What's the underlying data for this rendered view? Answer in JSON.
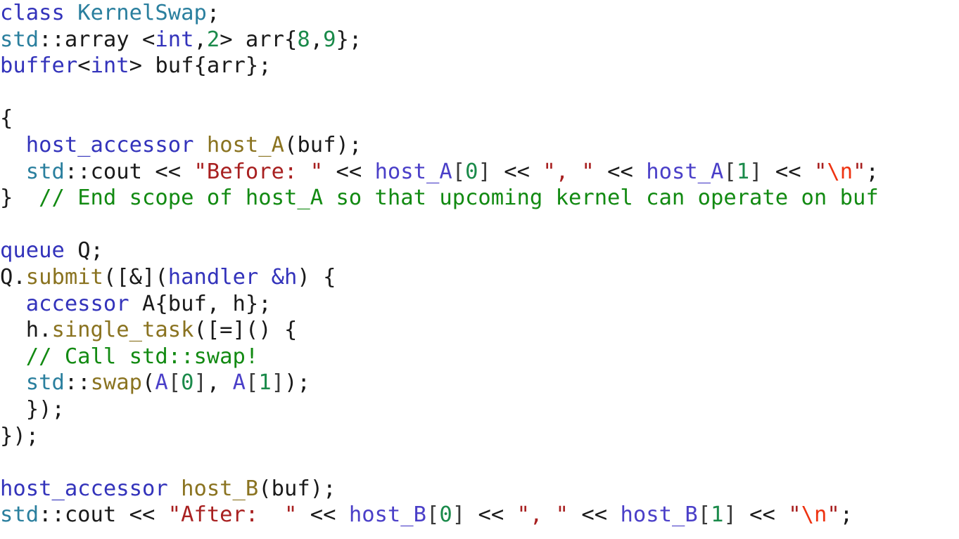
{
  "document": {
    "kind": "source-code-listing",
    "language": "C++ / SYCL",
    "background_color": "#ffffff",
    "colors": {
      "plain": "#1a1a1a",
      "keyword": "#3333bb",
      "type": "#2a7f9e",
      "function": "#8a7320",
      "number": "#1a8a4a",
      "string": "#a82020",
      "escape": "#ee3311",
      "comment": "#128a12",
      "variable": "#4a3fc8",
      "bracket": "#3a3a3a"
    },
    "plain_text": "class KernelSwap;\nstd::array <int,2> arr{8,9};\nbuffer<int> buf{arr};\n\n{\n  host_accessor host_A(buf);\n  std::cout << \"Before: \" << host_A[0] << \", \" << host_A[1] << \"\\n\";\n}  // End scope of host_A so that upcoming kernel can operate on buf\n\nqueue Q;\nQ.submit([&](handler &h) {\n  accessor A{buf, h};\n  h.single_task([=]() {\n  // Call std::swap!\n  std::swap(A[0], A[1]);\n  });\n});\n\nhost_accessor host_B(buf);\nstd::cout << \"After:  \" << host_B[0] << \", \" << host_B[1] << \"\\n\";",
    "lines": [
      {
        "n": 1,
        "tokens": [
          {
            "text": "class",
            "cls": "t-kw"
          },
          {
            "text": " ",
            "cls": "t-plain"
          },
          {
            "text": "KernelSwap",
            "cls": "t-type"
          },
          {
            "text": ";",
            "cls": "t-plain"
          }
        ]
      },
      {
        "n": 2,
        "tokens": [
          {
            "text": "std",
            "cls": "t-type"
          },
          {
            "text": "::array <",
            "cls": "t-plain"
          },
          {
            "text": "int",
            "cls": "t-kw"
          },
          {
            "text": ",",
            "cls": "t-plain"
          },
          {
            "text": "2",
            "cls": "t-num"
          },
          {
            "text": "> arr{",
            "cls": "t-plain"
          },
          {
            "text": "8",
            "cls": "t-num"
          },
          {
            "text": ",",
            "cls": "t-plain"
          },
          {
            "text": "9",
            "cls": "t-num"
          },
          {
            "text": "};",
            "cls": "t-plain"
          }
        ]
      },
      {
        "n": 3,
        "tokens": [
          {
            "text": "buffer",
            "cls": "t-kw"
          },
          {
            "text": "<",
            "cls": "t-plain"
          },
          {
            "text": "int",
            "cls": "t-kw"
          },
          {
            "text": "> buf{arr};",
            "cls": "t-plain"
          }
        ]
      },
      {
        "n": 4,
        "tokens": [
          {
            "text": " ",
            "cls": "t-plain"
          }
        ]
      },
      {
        "n": 5,
        "tokens": [
          {
            "text": "{",
            "cls": "t-plain"
          }
        ]
      },
      {
        "n": 6,
        "tokens": [
          {
            "text": "  ",
            "cls": "t-plain"
          },
          {
            "text": "host_accessor",
            "cls": "t-kw"
          },
          {
            "text": " ",
            "cls": "t-plain"
          },
          {
            "text": "host_A",
            "cls": "t-fn"
          },
          {
            "text": "(buf);",
            "cls": "t-plain"
          }
        ]
      },
      {
        "n": 7,
        "tokens": [
          {
            "text": "  ",
            "cls": "t-plain"
          },
          {
            "text": "std",
            "cls": "t-type"
          },
          {
            "text": "::cout << ",
            "cls": "t-plain"
          },
          {
            "text": "\"Before: \"",
            "cls": "t-str"
          },
          {
            "text": " << ",
            "cls": "t-plain"
          },
          {
            "text": "host_A",
            "cls": "t-var"
          },
          {
            "text": "[",
            "cls": "t-brk"
          },
          {
            "text": "0",
            "cls": "t-num"
          },
          {
            "text": "]",
            "cls": "t-brk"
          },
          {
            "text": " << ",
            "cls": "t-plain"
          },
          {
            "text": "\", \"",
            "cls": "t-str"
          },
          {
            "text": " << ",
            "cls": "t-plain"
          },
          {
            "text": "host_A",
            "cls": "t-var"
          },
          {
            "text": "[",
            "cls": "t-brk"
          },
          {
            "text": "1",
            "cls": "t-num"
          },
          {
            "text": "]",
            "cls": "t-brk"
          },
          {
            "text": " << ",
            "cls": "t-plain"
          },
          {
            "text": "\"",
            "cls": "t-str"
          },
          {
            "text": "\\n",
            "cls": "t-esc"
          },
          {
            "text": "\"",
            "cls": "t-str"
          },
          {
            "text": ";",
            "cls": "t-plain"
          }
        ]
      },
      {
        "n": 8,
        "tokens": [
          {
            "text": "}",
            "cls": "t-plain"
          },
          {
            "text": "  ",
            "cls": "t-plain"
          },
          {
            "text": "// End scope of host_A so that upcoming kernel can operate on buf",
            "cls": "t-cmt"
          }
        ]
      },
      {
        "n": 9,
        "tokens": [
          {
            "text": " ",
            "cls": "t-plain"
          }
        ]
      },
      {
        "n": 10,
        "tokens": [
          {
            "text": "queue",
            "cls": "t-kw"
          },
          {
            "text": " Q;",
            "cls": "t-plain"
          }
        ]
      },
      {
        "n": 11,
        "tokens": [
          {
            "text": "Q.",
            "cls": "t-plain"
          },
          {
            "text": "submit",
            "cls": "t-fn"
          },
          {
            "text": "([&](",
            "cls": "t-plain"
          },
          {
            "text": "handler",
            "cls": "t-kw"
          },
          {
            "text": " ",
            "cls": "t-plain"
          },
          {
            "text": "&h",
            "cls": "t-kw"
          },
          {
            "text": ") {",
            "cls": "t-plain"
          }
        ]
      },
      {
        "n": 12,
        "tokens": [
          {
            "text": "  ",
            "cls": "t-plain"
          },
          {
            "text": "accessor",
            "cls": "t-kw"
          },
          {
            "text": " A{buf, h};",
            "cls": "t-plain"
          }
        ]
      },
      {
        "n": 13,
        "tokens": [
          {
            "text": "  h.",
            "cls": "t-plain"
          },
          {
            "text": "single_task",
            "cls": "t-fn"
          },
          {
            "text": "([=]() {",
            "cls": "t-plain"
          }
        ]
      },
      {
        "n": 14,
        "tokens": [
          {
            "text": "  ",
            "cls": "t-plain"
          },
          {
            "text": "// Call std::swap!",
            "cls": "t-cmt"
          }
        ]
      },
      {
        "n": 15,
        "tokens": [
          {
            "text": "  ",
            "cls": "t-plain"
          },
          {
            "text": "std",
            "cls": "t-type"
          },
          {
            "text": "::",
            "cls": "t-plain"
          },
          {
            "text": "swap",
            "cls": "t-fn"
          },
          {
            "text": "(",
            "cls": "t-plain"
          },
          {
            "text": "A",
            "cls": "t-var"
          },
          {
            "text": "[",
            "cls": "t-brk"
          },
          {
            "text": "0",
            "cls": "t-num"
          },
          {
            "text": "]",
            "cls": "t-brk"
          },
          {
            "text": ", ",
            "cls": "t-plain"
          },
          {
            "text": "A",
            "cls": "t-var"
          },
          {
            "text": "[",
            "cls": "t-brk"
          },
          {
            "text": "1",
            "cls": "t-num"
          },
          {
            "text": "]",
            "cls": "t-brk"
          },
          {
            "text": ");",
            "cls": "t-plain"
          }
        ]
      },
      {
        "n": 16,
        "tokens": [
          {
            "text": "  });",
            "cls": "t-plain"
          }
        ]
      },
      {
        "n": 17,
        "tokens": [
          {
            "text": "});",
            "cls": "t-plain"
          }
        ]
      },
      {
        "n": 18,
        "tokens": [
          {
            "text": " ",
            "cls": "t-plain"
          }
        ]
      },
      {
        "n": 19,
        "tokens": [
          {
            "text": "host_accessor",
            "cls": "t-kw"
          },
          {
            "text": " ",
            "cls": "t-plain"
          },
          {
            "text": "host_B",
            "cls": "t-fn"
          },
          {
            "text": "(buf);",
            "cls": "t-plain"
          }
        ]
      },
      {
        "n": 20,
        "tokens": [
          {
            "text": "std",
            "cls": "t-type"
          },
          {
            "text": "::cout << ",
            "cls": "t-plain"
          },
          {
            "text": "\"After:  \"",
            "cls": "t-str"
          },
          {
            "text": " << ",
            "cls": "t-plain"
          },
          {
            "text": "host_B",
            "cls": "t-var"
          },
          {
            "text": "[",
            "cls": "t-brk"
          },
          {
            "text": "0",
            "cls": "t-num"
          },
          {
            "text": "]",
            "cls": "t-brk"
          },
          {
            "text": " << ",
            "cls": "t-plain"
          },
          {
            "text": "\", \"",
            "cls": "t-str"
          },
          {
            "text": " << ",
            "cls": "t-plain"
          },
          {
            "text": "host_B",
            "cls": "t-var"
          },
          {
            "text": "[",
            "cls": "t-brk"
          },
          {
            "text": "1",
            "cls": "t-num"
          },
          {
            "text": "]",
            "cls": "t-brk"
          },
          {
            "text": " << ",
            "cls": "t-plain"
          },
          {
            "text": "\"",
            "cls": "t-str"
          },
          {
            "text": "\\n",
            "cls": "t-esc"
          },
          {
            "text": "\"",
            "cls": "t-str"
          },
          {
            "text": ";",
            "cls": "t-plain"
          }
        ]
      }
    ]
  }
}
